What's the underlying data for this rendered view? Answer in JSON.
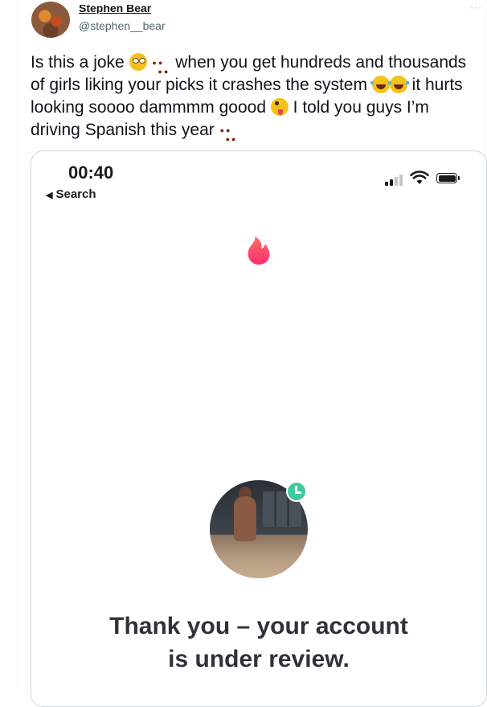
{
  "tweet": {
    "author": {
      "display_name": "Stephen Bear",
      "handle": "@stephen__bear",
      "avatar_icon": "avatar-photo"
    },
    "more_icon": "···",
    "text_segments": [
      "Is this a joke ",
      " when you get hundreds and thousands of girls liking your picks it crashes the system ",
      " it hurts looking soooo dammmm goood ",
      " I told you guys I’m driving Spanish this year "
    ],
    "emojis": [
      "face-with-rolling-eyes",
      "paw-prints",
      "face-with-tears-of-joy",
      "face-with-tears-of-joy",
      "zany-face",
      "paw-prints"
    ]
  },
  "screenshot": {
    "status_bar": {
      "time": "00:40",
      "back_label": "Search",
      "back_icon": "◀"
    },
    "flame_color": "#fd5068",
    "badge_color": "#3ec9a0",
    "message_line1": "Thank you – your account",
    "message_line2": "is under review."
  }
}
